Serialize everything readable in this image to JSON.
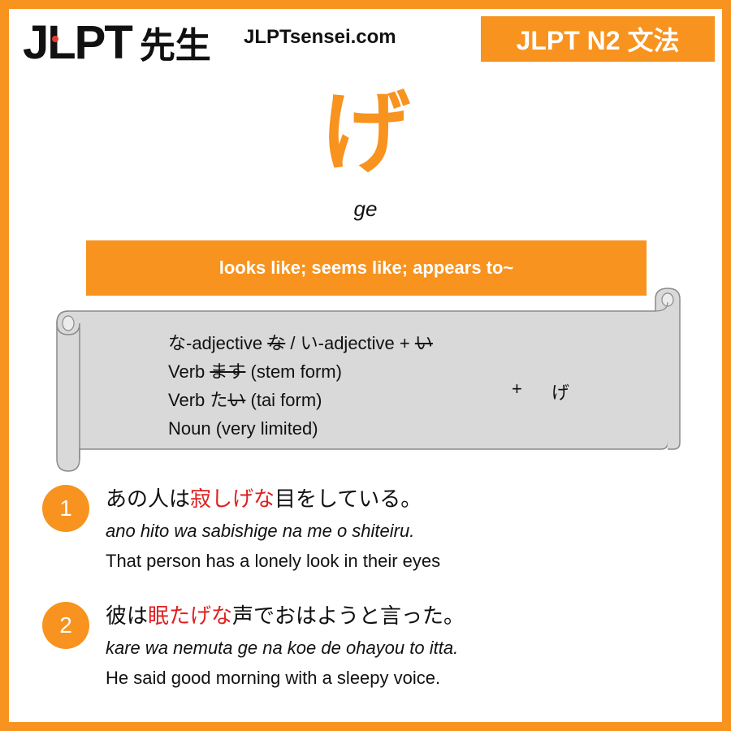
{
  "header": {
    "logo_text": "JLPT",
    "logo_kanji": "先生",
    "site": "JLPTsensei.com",
    "level": "JLPT N2 文法"
  },
  "grammar": {
    "kana": "げ",
    "romaji": "ge",
    "meaning": "looks like; seems like; appears to~"
  },
  "formation": {
    "line1_a": "な-adjective ",
    "line1_strike1": "な",
    "line1_b": "  / い-adjective + ",
    "line1_strike2": "い",
    "line2_a": "Verb ",
    "line2_strike": "ます",
    "line2_b": " (stem form)",
    "line3_a": "Verb た",
    "line3_strike": "い",
    "line3_b": " (tai form)",
    "line4": "Noun (very limited)",
    "plus": "+",
    "result": "げ"
  },
  "examples": [
    {
      "number": "1",
      "jp_pre": "あの人は",
      "jp_hl": "寂しげな",
      "jp_post": "目をしている。",
      "romaji": "ano hito wa sabishige na me o shiteiru.",
      "english": "That person has a lonely look in their eyes"
    },
    {
      "number": "2",
      "jp_pre": "彼は",
      "jp_hl": "眠たげな",
      "jp_post": "声でおはようと言った。",
      "romaji": "kare wa nemuta ge na koe de ohayou to itta.",
      "english": "He said good morning with a sleepy voice."
    }
  ],
  "colors": {
    "accent": "#f7931e",
    "highlight": "#e01f1f",
    "scroll": "#d9d9d9"
  }
}
